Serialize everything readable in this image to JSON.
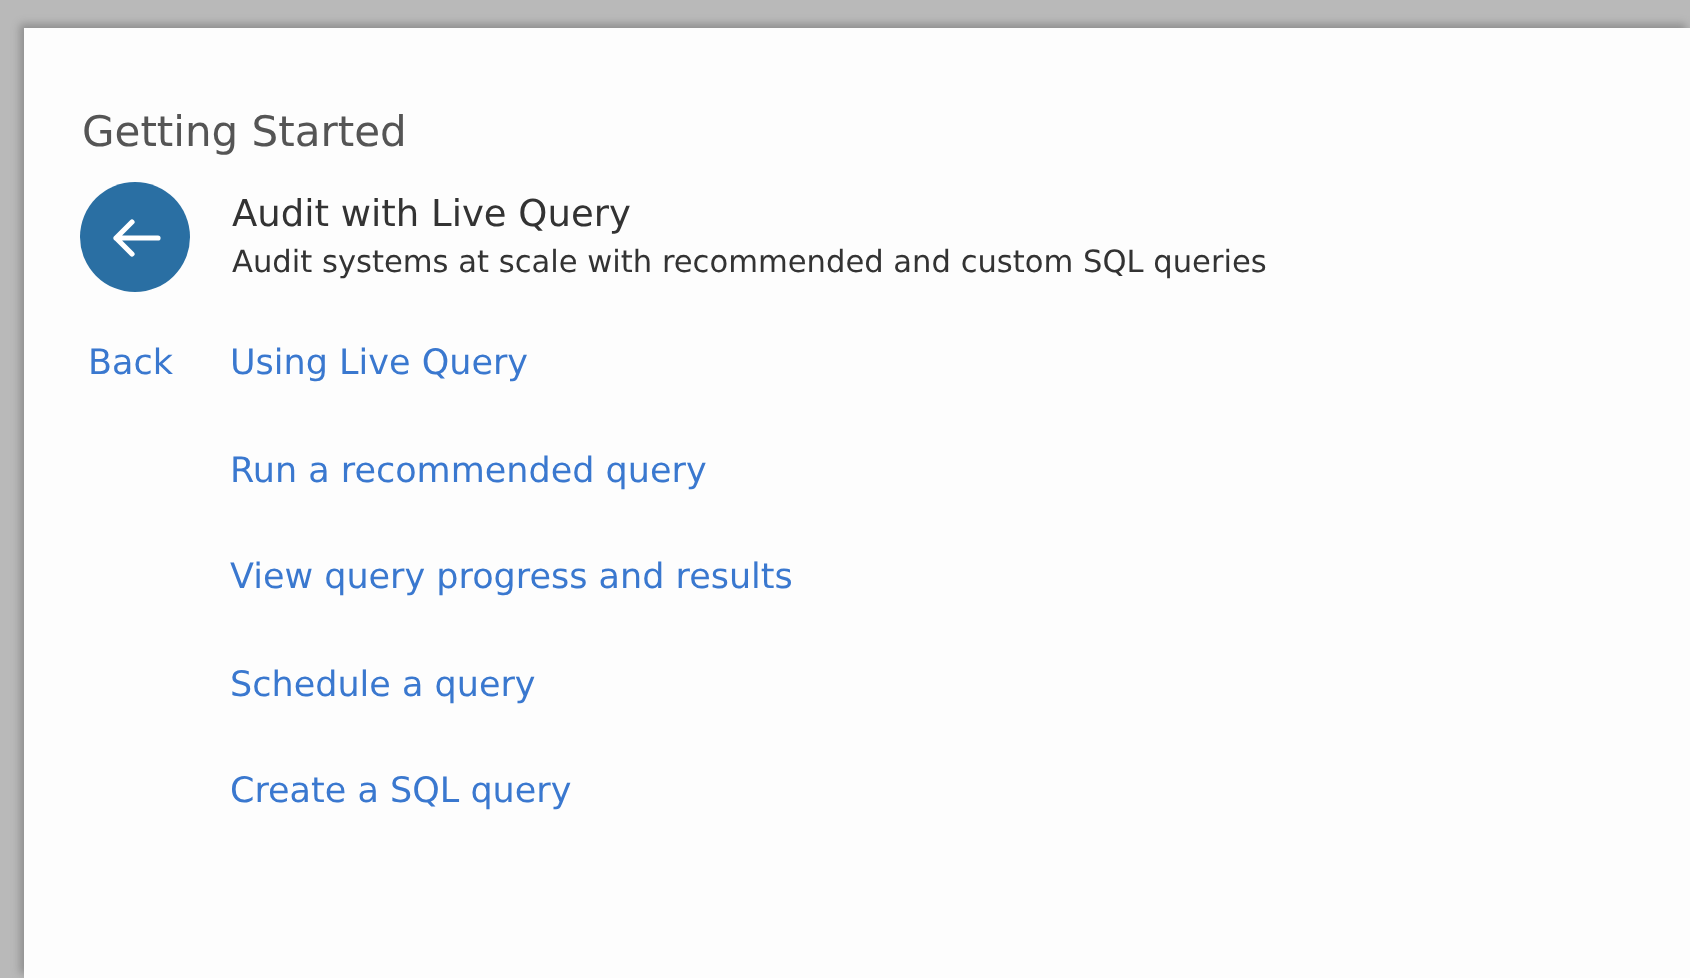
{
  "panel": {
    "title": "Getting Started"
  },
  "header": {
    "title": "Audit with Live Query",
    "subtitle": "Audit systems at scale with recommended and custom SQL queries"
  },
  "back": {
    "label": "Back"
  },
  "links": [
    "Using Live Query",
    "Run a recommended query",
    "View query progress and results",
    "Schedule a query",
    "Create a SQL query"
  ]
}
